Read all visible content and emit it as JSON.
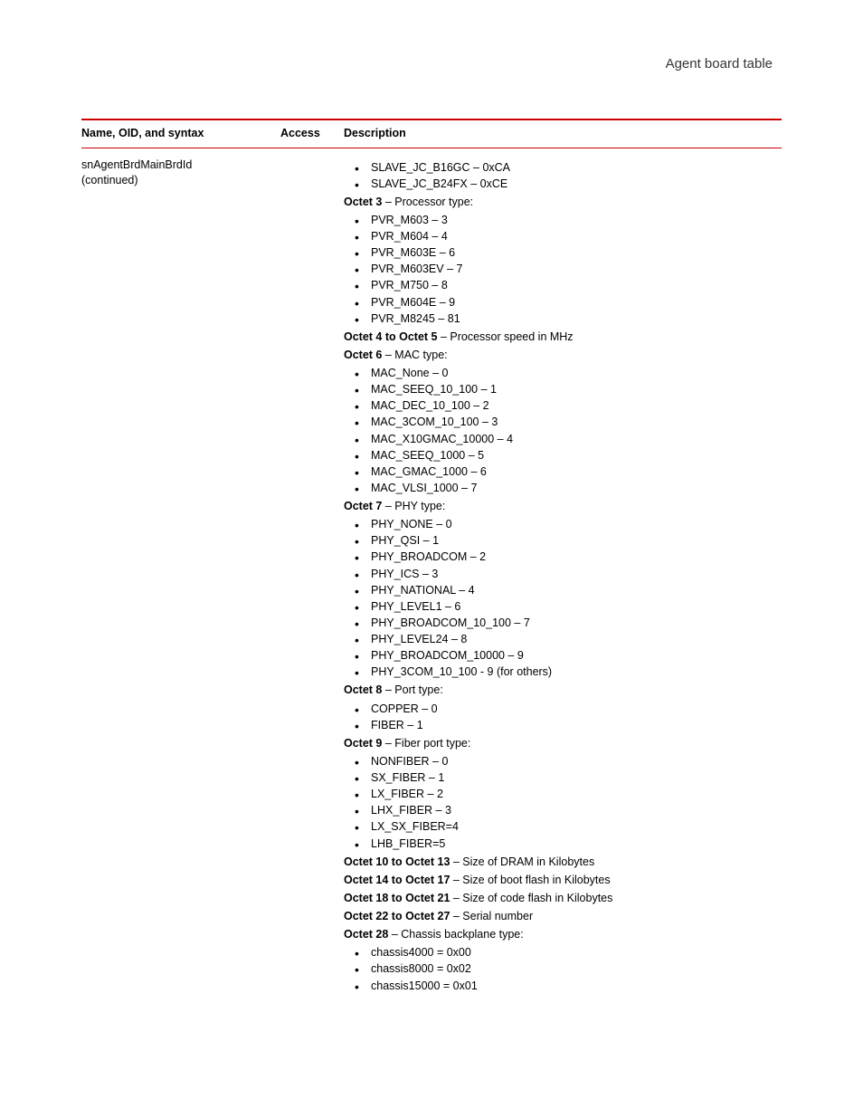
{
  "header": {
    "title": "Agent board table"
  },
  "table": {
    "columns": {
      "name": "Name, OID, and syntax",
      "access": "Access",
      "description": "Description"
    },
    "row": {
      "name": "snAgentBrdMainBrdId",
      "continued": "(continued)",
      "access": ""
    }
  },
  "desc": {
    "list1": [
      "SLAVE_JC_B16GC – 0xCA",
      "SLAVE_JC_B24FX – 0xCE"
    ],
    "octet3_label": "Octet 3",
    "octet3_text": " – Processor type:",
    "list_octet3": [
      "PVR_M603 – 3",
      "PVR_M604 – 4",
      "PVR_M603E – 6",
      "PVR_M603EV – 7",
      "PVR_M750 – 8",
      "PVR_M604E – 9",
      "PVR_M8245 – 81"
    ],
    "octet4_5_label": "Octet 4 to Octet 5",
    "octet4_5_text": " – Processor speed in MHz",
    "octet6_label": "Octet 6",
    "octet6_text": " – MAC type:",
    "list_octet6": [
      "MAC_None – 0",
      "MAC_SEEQ_10_100 – 1",
      "MAC_DEC_10_100 – 2",
      "MAC_3COM_10_100 – 3",
      "MAC_X10GMAC_10000 – 4",
      "MAC_SEEQ_1000 – 5",
      "MAC_GMAC_1000 – 6",
      "MAC_VLSI_1000 – 7"
    ],
    "octet7_label": "Octet 7",
    "octet7_text": " – PHY type:",
    "list_octet7": [
      "PHY_NONE – 0",
      "PHY_QSI – 1",
      "PHY_BROADCOM – 2",
      "PHY_ICS – 3",
      "PHY_NATIONAL – 4",
      "PHY_LEVEL1 – 6",
      "PHY_BROADCOM_10_100 – 7",
      "PHY_LEVEL24 – 8",
      "PHY_BROADCOM_10000 – 9",
      "PHY_3COM_10_100 - 9 (for others)"
    ],
    "octet8_label": "Octet 8",
    "octet8_text": " – Port type:",
    "list_octet8": [
      "COPPER – 0",
      "FIBER – 1"
    ],
    "octet9_label": "Octet 9",
    "octet9_text": " – Fiber port type:",
    "list_octet9": [
      "NONFIBER – 0",
      "SX_FIBER – 1",
      "LX_FIBER – 2",
      "LHX_FIBER – 3",
      "LX_SX_FIBER=4",
      "LHB_FIBER=5"
    ],
    "octet10_13_label": "Octet 10 to Octet 13",
    "octet10_13_text": " – Size of DRAM in Kilobytes",
    "octet14_17_label": "Octet 14 to Octet 17",
    "octet14_17_text": " – Size of boot flash in Kilobytes",
    "octet18_21_label": "Octet 18 to Octet 21",
    "octet18_21_text": " – Size of code flash in Kilobytes",
    "octet22_27_label": "Octet 22 to Octet 27",
    "octet22_27_text": " – Serial number",
    "octet28_label": "Octet 28",
    "octet28_text": " – Chassis backplane type:",
    "list_octet28": [
      "chassis4000 = 0x00",
      "chassis8000 = 0x02",
      "chassis15000 = 0x01"
    ]
  }
}
